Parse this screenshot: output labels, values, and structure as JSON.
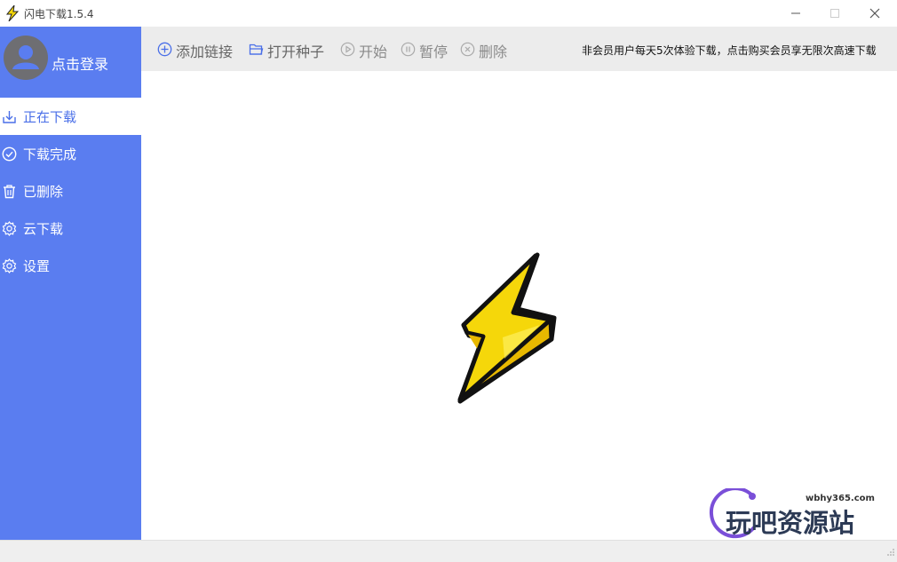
{
  "window": {
    "title": "闪电下载1.5.4",
    "icons": {
      "app": "lightning-icon",
      "minimize": "minimize-icon",
      "maximize": "maximize-icon",
      "close": "close-icon"
    }
  },
  "sidebar": {
    "login_label": "点击登录",
    "items": [
      {
        "label": "正在下载",
        "icon": "download-icon",
        "active": true
      },
      {
        "label": "下载完成",
        "icon": "check-circle-icon",
        "active": false
      },
      {
        "label": "已删除",
        "icon": "trash-icon",
        "active": false
      },
      {
        "label": "云下载",
        "icon": "gear-icon",
        "active": false
      },
      {
        "label": "设置",
        "icon": "gear-icon",
        "active": false
      }
    ]
  },
  "toolbar": {
    "add_link": "添加链接",
    "open_torrent": "打开种子",
    "start": "开始",
    "pause": "暂停",
    "delete": "删除",
    "notice": "非会员用户每天5次体验下载，点击购买会员享无限次高速下载"
  },
  "watermark": {
    "url": "wbhy365.com",
    "text": "玩吧资源站"
  },
  "colors": {
    "sidebar": "#5a7df0",
    "accent": "#4a6fe8",
    "bolt_yellow": "#f5d70a",
    "toolbar_bg": "#ececec"
  }
}
